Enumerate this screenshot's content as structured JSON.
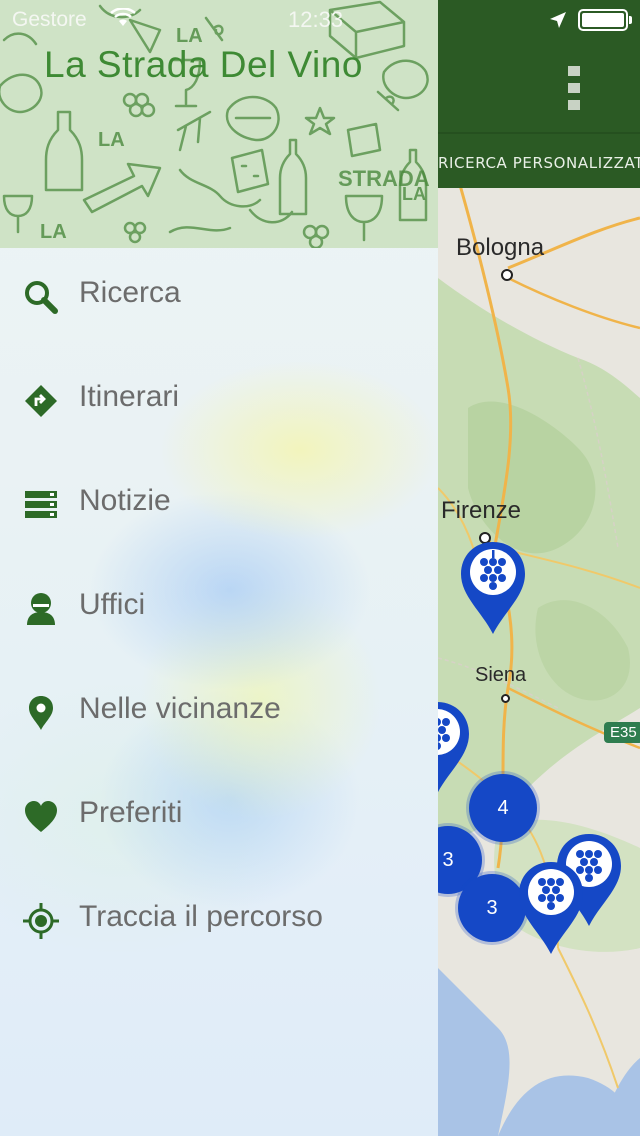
{
  "status_bar": {
    "carrier": "Gestore",
    "time": "12:33"
  },
  "drawer": {
    "title": "La Strada Del Vino",
    "menu": [
      {
        "label": "Ricerca",
        "icon": "search-icon"
      },
      {
        "label": "Itinerari",
        "icon": "directions-icon"
      },
      {
        "label": "Notizie",
        "icon": "news-list-icon"
      },
      {
        "label": "Uffici",
        "icon": "person-icon"
      },
      {
        "label": "Nelle vicinanze",
        "icon": "location-pin-icon"
      },
      {
        "label": "Preferiti",
        "icon": "heart-icon"
      },
      {
        "label": "Traccia il percorso",
        "icon": "gps-target-icon"
      }
    ]
  },
  "background_screen": {
    "tab_label": "RICERCA PERSONALIZZATA",
    "map": {
      "cities": [
        "Bologna",
        "Firenze",
        "Siena"
      ],
      "road_label": "E35",
      "clusters": [
        "4",
        "3",
        "3"
      ]
    }
  },
  "colors": {
    "header_green": "#2b5a24",
    "title_green": "#3e8a34",
    "icon_green": "#2d6a27",
    "cluster_blue": "#1548c6"
  }
}
